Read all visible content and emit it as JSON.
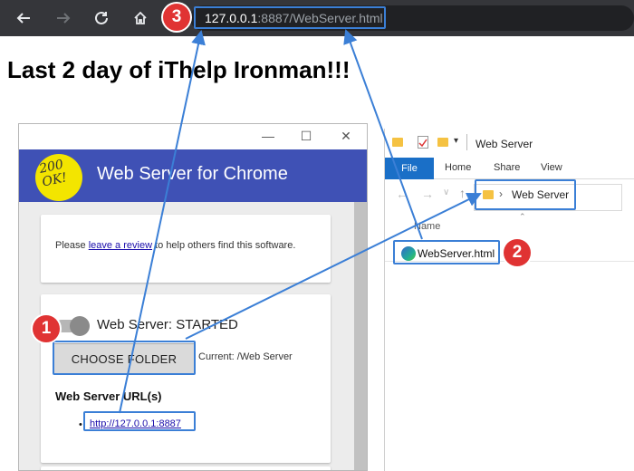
{
  "browser": {
    "url_host": "127.0.0.1",
    "url_rest": ":8887/WebServer.html"
  },
  "page": {
    "heading": "Last 2 day of iThelp Ironman!!!"
  },
  "webserver_app": {
    "logo_text_line1": "200",
    "logo_text_line2": "OK!",
    "title": "Web Server for Chrome",
    "review_prefix": "Please ",
    "review_link": "leave a review",
    "review_suffix": " to help others find this software.",
    "status": "Web Server: STARTED",
    "choose_folder_label": "CHOOSE FOLDER",
    "current_folder": "Current: /Web Server",
    "urls_heading": "Web Server URL(s)",
    "server_url": "http://127.0.0.1:8887"
  },
  "explorer": {
    "window_title": "Web Server",
    "ribbon_tabs": [
      "File",
      "Home",
      "Share",
      "View"
    ],
    "address_path": "Web Server",
    "column_header": "Name",
    "file_name": "WebServer.html"
  },
  "annotations": {
    "badge_1": "1",
    "badge_2": "2",
    "badge_3": "3",
    "color": "#3b7fd6",
    "badge_color": "#e03333"
  }
}
